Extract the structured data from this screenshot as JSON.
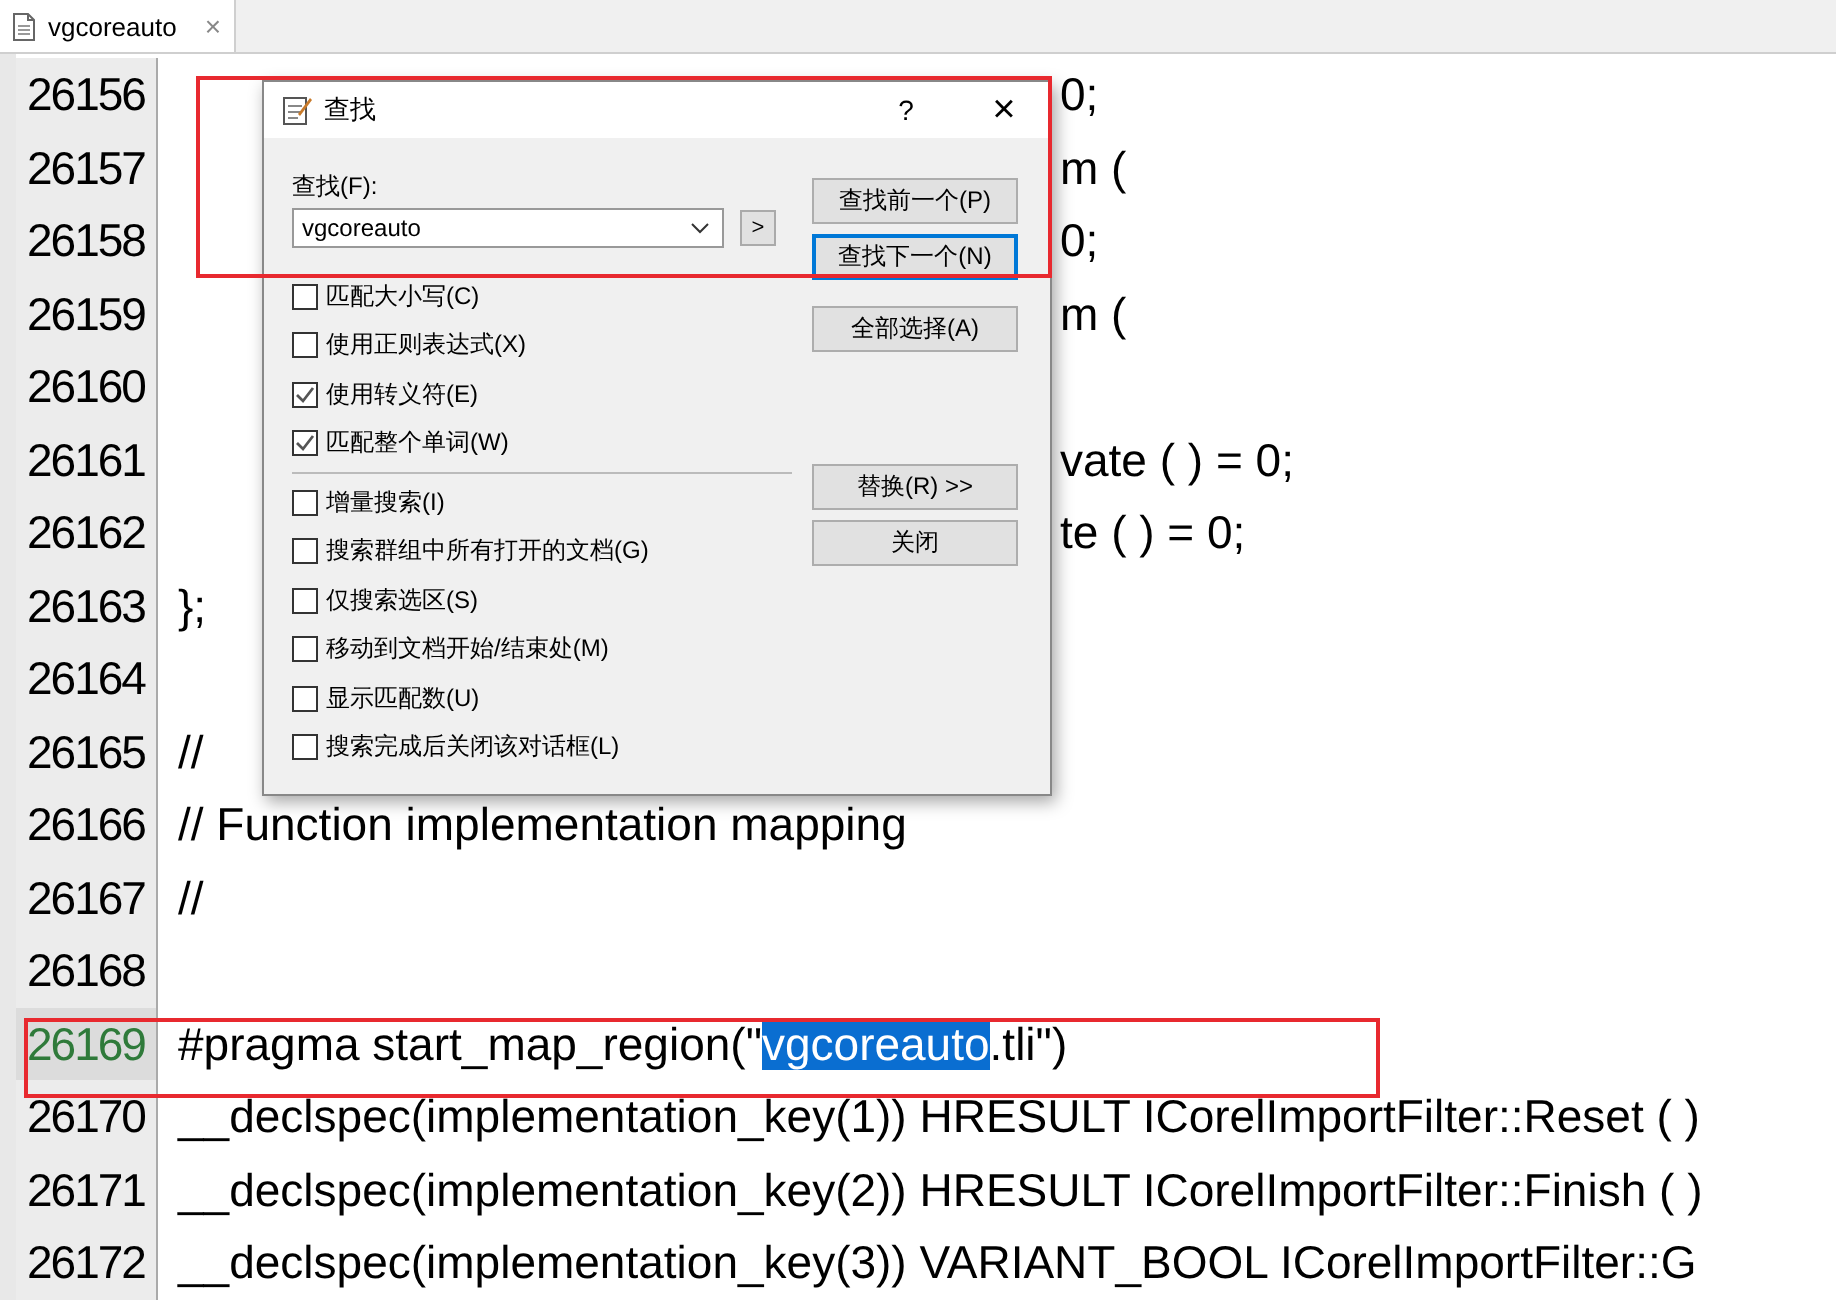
{
  "tab": {
    "title": "vgcoreauto",
    "close": "×"
  },
  "lines": [
    {
      "number": "26156",
      "tail": "0;",
      "current": false
    },
    {
      "number": "26157",
      "tail": "m (",
      "current": false
    },
    {
      "number": "26158",
      "tail": "0;",
      "current": false
    },
    {
      "number": "26159",
      "tail": "m (",
      "current": false
    },
    {
      "number": "26160",
      "current": false
    },
    {
      "number": "26161",
      "tail": "vate ( ) = 0;",
      "current": false
    },
    {
      "number": "26162",
      "tail": "te ( ) = 0;",
      "current": false
    },
    {
      "number": "26163",
      "segments": [
        {
          "text": "};",
          "selected": false
        }
      ],
      "current": false
    },
    {
      "number": "26164",
      "current": false
    },
    {
      "number": "26165",
      "segments": [
        {
          "text": "//",
          "selected": false
        }
      ],
      "current": false
    },
    {
      "number": "26166",
      "segments": [
        {
          "text": "// Function implementation mapping",
          "selected": false
        }
      ],
      "current": false
    },
    {
      "number": "26167",
      "segments": [
        {
          "text": "//",
          "selected": false
        }
      ],
      "current": false
    },
    {
      "number": "26168",
      "current": false
    },
    {
      "number": "26169",
      "segments": [
        {
          "text": "#pragma start_map_region(\"",
          "selected": false
        },
        {
          "text": "vgcoreauto",
          "selected": true
        },
        {
          "text": ".tli\")",
          "selected": false
        }
      ],
      "current": true
    },
    {
      "number": "26170",
      "segments": [
        {
          "text": "__declspec(implementation_key(1)) HRESULT ICorelImportFilter::Reset ( )",
          "selected": false
        }
      ],
      "current": false
    },
    {
      "number": "26171",
      "segments": [
        {
          "text": "__declspec(implementation_key(2)) HRESULT ICorelImportFilter::Finish ( )",
          "selected": false
        }
      ],
      "current": false
    },
    {
      "number": "26172",
      "segments": [
        {
          "text": "__declspec(implementation_key(3)) VARIANT_BOOL ICorelImportFilter::G",
          "selected": false
        }
      ],
      "current": false
    }
  ],
  "dialog": {
    "title": "查找",
    "help": "?",
    "close": "×",
    "find_label": "查找(F):",
    "find_value": "vgcoreauto",
    "arrow_button": ">",
    "buttons_top": [
      {
        "label": "查找前一个(P)",
        "default": false
      },
      {
        "label": "查找下一个(N)",
        "default": true
      },
      {
        "label": "全部选择(A)",
        "default": false
      }
    ],
    "options": [
      {
        "label": "匹配大小写(C)",
        "checked": false
      },
      {
        "label": "使用正则表达式(X)",
        "checked": false
      },
      {
        "label": "使用转义符(E)",
        "checked": true
      },
      {
        "label": "匹配整个单词(W)",
        "checked": true
      }
    ],
    "options_more": [
      {
        "label": "增量搜索(I)",
        "checked": false
      },
      {
        "label": "搜索群组中所有打开的文档(G)",
        "checked": false
      },
      {
        "label": "仅搜索选区(S)",
        "checked": false
      },
      {
        "label": "移动到文档开始/结束处(M)",
        "checked": false
      },
      {
        "label": "显示匹配数(U)",
        "checked": false
      },
      {
        "label": "搜索完成后关闭该对话框(L)",
        "checked": false
      }
    ],
    "buttons_bottom": [
      {
        "label": "替换(R) >>",
        "default": false
      },
      {
        "label": "关闭",
        "default": false
      }
    ]
  }
}
